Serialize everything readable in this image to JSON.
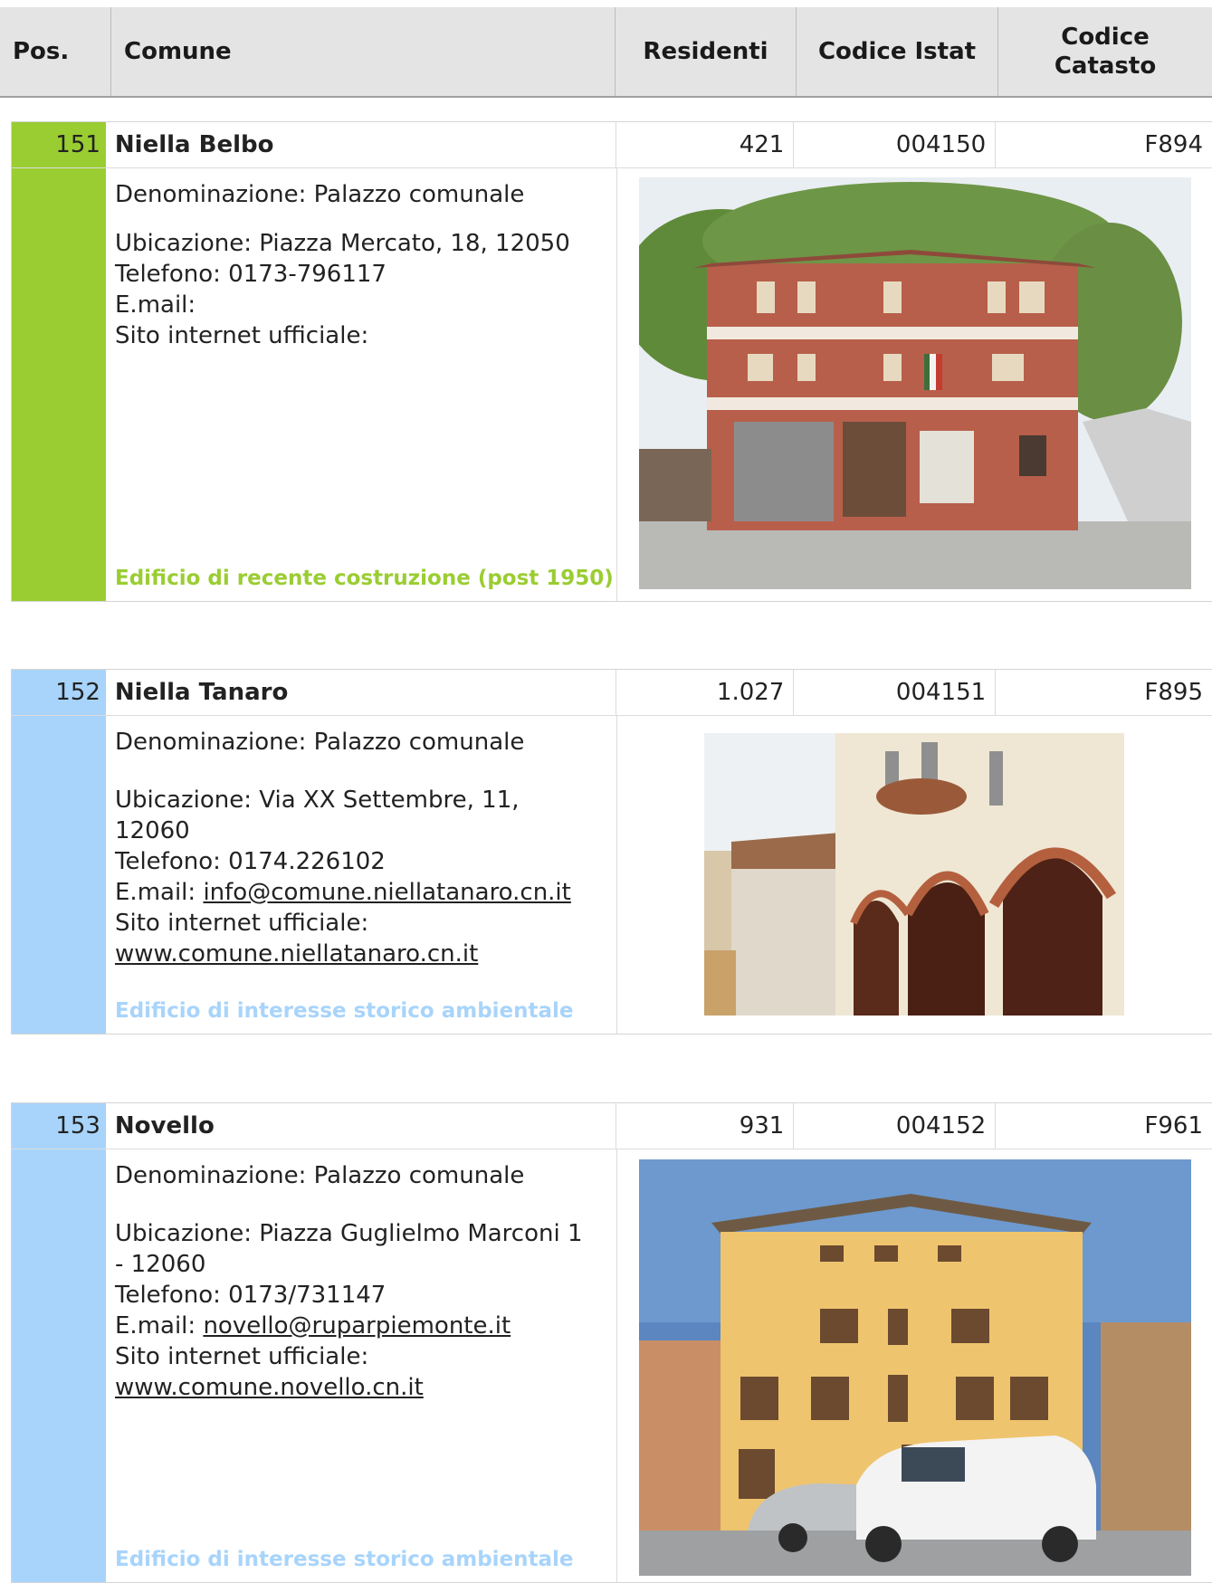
{
  "header": {
    "pos": "Pos.",
    "comune": "Comune",
    "residenti": "Residenti",
    "codice_istat": "Codice Istat",
    "codice_catasto_1": "Codice",
    "codice_catasto_2": "Catasto"
  },
  "entries": [
    {
      "pos": "151",
      "name": "Niella Belbo",
      "residenti": "421",
      "istat": "004150",
      "catasto": "F894",
      "denominazione": "Denominazione: Palazzo comunale",
      "ubicazione": "Ubicazione: Piazza Mercato, 18, 12050",
      "telefono": "Telefono: 0173-796117",
      "email_label": "E.mail:",
      "email": "",
      "sito_label": "Sito internet ufficiale:",
      "sito": "",
      "category": "Edificio di recente costruzione (post 1950)",
      "color": "#9acd32",
      "category_color": "#9acd32"
    },
    {
      "pos": "152",
      "name": "Niella Tanaro",
      "residenti": "1.027",
      "istat": "004151",
      "catasto": "F895",
      "denominazione": "Denominazione: Palazzo comunale",
      "ubicazione_1": "Ubicazione: Via XX Settembre, 11,",
      "ubicazione_2": "12060",
      "telefono": "Telefono: 0174.226102",
      "email_label": "E.mail:",
      "email": "info@comune.niellatanaro.cn.it",
      "sito_label": "Sito internet ufficiale:",
      "sito": "www.comune.niellatanaro.cn.it",
      "category": "Edificio  di interesse storico ambientale",
      "color": "#a8d4fb",
      "category_color": "#a8d4fb"
    },
    {
      "pos": "153",
      "name": "Novello",
      "residenti": "931",
      "istat": "004152",
      "catasto": "F961",
      "denominazione": "Denominazione: Palazzo comunale",
      "ubicazione_1": "Ubicazione: Piazza Guglielmo Marconi 1",
      "ubicazione_2": "- 12060",
      "telefono": "Telefono: 0173/731147",
      "email_label": "E.mail:",
      "email": "novello@ruparpiemonte.it",
      "sito_label": "Sito internet ufficiale:",
      "sito": "www.comune.novello.cn.it",
      "category": "Edificio di interesse storico ambientale",
      "color": "#a8d4fb",
      "category_color": "#a8d4fb"
    }
  ]
}
